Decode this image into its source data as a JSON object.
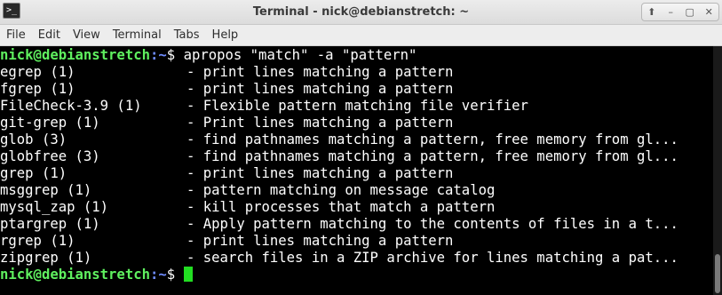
{
  "window": {
    "title": "Terminal - nick@debianstretch: ~",
    "icon": "terminal-app-icon",
    "controls": [
      "maximize-up-icon",
      "minimize-icon",
      "maximize-icon",
      "close-icon"
    ]
  },
  "menu": {
    "file": "File",
    "edit": "Edit",
    "view": "View",
    "terminal": "Terminal",
    "tabs": "Tabs",
    "help": "Help"
  },
  "terminal": {
    "prompt_user": "nick@debianstretch",
    "prompt_path": ":~",
    "prompt_sign": "$ ",
    "command": "apropos \"match\" -a \"pattern\"",
    "results": [
      {
        "cmd": "egrep (1)",
        "desc": "- print lines matching a pattern"
      },
      {
        "cmd": "fgrep (1)",
        "desc": "- print lines matching a pattern"
      },
      {
        "cmd": "FileCheck-3.9 (1)",
        "desc": "- Flexible pattern matching file verifier"
      },
      {
        "cmd": "git-grep (1)",
        "desc": "- Print lines matching a pattern"
      },
      {
        "cmd": "glob (3)",
        "desc": "- find pathnames matching a pattern, free memory from gl..."
      },
      {
        "cmd": "globfree (3)",
        "desc": "- find pathnames matching a pattern, free memory from gl..."
      },
      {
        "cmd": "grep (1)",
        "desc": "- print lines matching a pattern"
      },
      {
        "cmd": "msggrep (1)",
        "desc": "- pattern matching on message catalog"
      },
      {
        "cmd": "mysql_zap (1)",
        "desc": "- kill processes that match a pattern"
      },
      {
        "cmd": "ptargrep (1)",
        "desc": "- Apply pattern matching to the contents of files in a t..."
      },
      {
        "cmd": "rgrep (1)",
        "desc": "- print lines matching a pattern"
      },
      {
        "cmd": "zipgrep (1)",
        "desc": "- search files in a ZIP archive for lines matching a pat..."
      }
    ]
  },
  "colors": {
    "prompt_user": "#5ff05f",
    "prompt_path": "#6f8cff",
    "cursor": "#22dd22",
    "background": "#000000",
    "text": "#ffffff"
  }
}
